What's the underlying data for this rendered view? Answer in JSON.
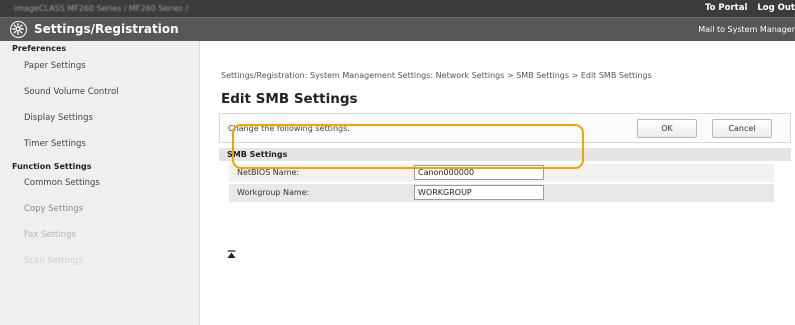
{
  "topbar": {
    "breadcrumb": "imageCLASS  MF260 Series / MF260 Series /",
    "portal_link": "To Portal",
    "logout_link": "Log Out"
  },
  "header": {
    "title": "Settings/Registration",
    "mail_link": "Mail to System Manager"
  },
  "sidebar": {
    "preferences_heading": "Preferences",
    "preferences_items": [
      {
        "label": "Paper Settings"
      },
      {
        "label": "Sound Volume Control"
      },
      {
        "label": "Display Settings"
      },
      {
        "label": "Timer Settings"
      }
    ],
    "function_heading": "Function Settings",
    "function_items": [
      {
        "label": "Common Settings"
      },
      {
        "label": "Copy Settings"
      },
      {
        "label": "Fax Settings"
      },
      {
        "label": "Scan Settings"
      }
    ]
  },
  "main": {
    "breadcrumb": "Settings/Registration: System Management Settings: Network Settings > SMB Settings > Edit SMB Settings",
    "title": "Edit SMB Settings",
    "hint": "Change the following settings.",
    "ok_label": "OK",
    "cancel_label": "Cancel",
    "section_title": "SMB Settings",
    "fields": [
      {
        "label": "NetBIOS Name:",
        "value": "Canon000000"
      },
      {
        "label": "Workgroup Name:",
        "value": "WORKGROUP"
      }
    ]
  },
  "colors": {
    "topbar": "#3c3c3c",
    "header": "#575757",
    "sidebar": "#efefef",
    "highlight": "#f2a500"
  },
  "icons": {
    "logo": "settings-gear-icon",
    "back_to_top": "back-to-top-icon"
  }
}
